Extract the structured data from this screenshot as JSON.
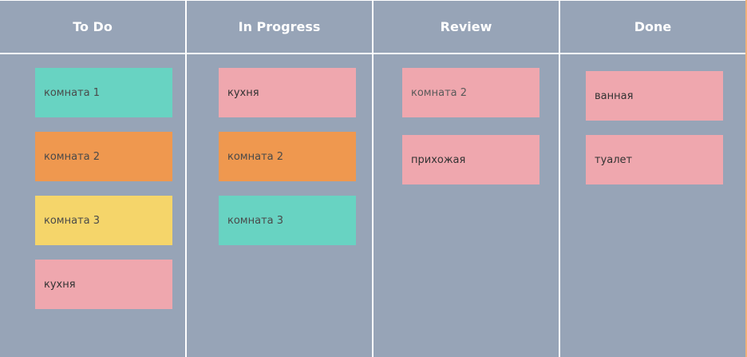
{
  "board": {
    "columns": [
      {
        "title": "To Do",
        "cards": [
          {
            "label": "комната 1",
            "color": "#68d3c2"
          },
          {
            "label": "комната 2",
            "color": "#ef984f"
          },
          {
            "label": "комната 3",
            "color": "#f5d56a"
          },
          {
            "label": "кухня",
            "color": "#efa7ae"
          }
        ]
      },
      {
        "title": "In Progress",
        "cards": [
          {
            "label": "кухня",
            "color": "#efa7ae"
          },
          {
            "label": "комната 2",
            "color": "#ef984f"
          },
          {
            "label": "комната 3",
            "color": "#68d3c2"
          }
        ]
      },
      {
        "title": "Review",
        "cards": [
          {
            "label": "комната 2",
            "color": "#efa7ae"
          },
          {
            "label": "прихожая",
            "color": "#efa7ae"
          }
        ]
      },
      {
        "title": "Done",
        "cards": [
          {
            "label": "ванная",
            "color": "#efa7ae"
          },
          {
            "label": "туалет",
            "color": "#efa7ae"
          }
        ]
      }
    ],
    "background": "#97a4b7"
  }
}
